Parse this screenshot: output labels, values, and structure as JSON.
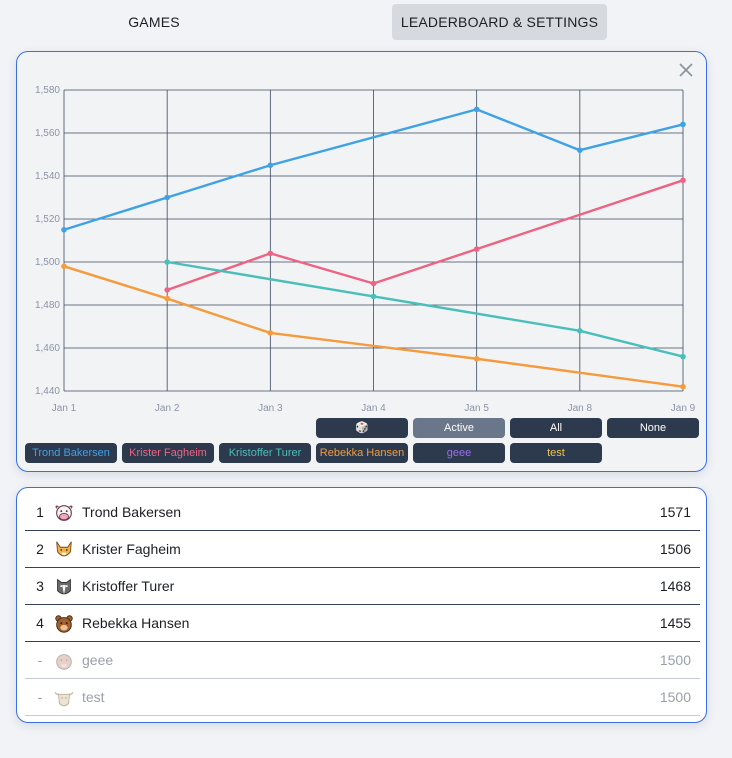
{
  "tabs": {
    "games": "GAMES",
    "leaderboard": "LEADERBOARD & SETTINGS"
  },
  "chart_data": {
    "type": "line",
    "categories": [
      "Jan 1",
      "Jan 2",
      "Jan 3",
      "Jan 4",
      "Jan 5",
      "Jan 8",
      "Jan 9"
    ],
    "y_ticks": [
      1440,
      1460,
      1480,
      1500,
      1520,
      1540,
      1560,
      1580
    ],
    "y_tick_labels": [
      "1,440",
      "1,460",
      "1,480",
      "1,500",
      "1,520",
      "1,540",
      "1,560",
      "1,580"
    ],
    "ylim": [
      1440,
      1580
    ],
    "grid": true,
    "series": [
      {
        "name": "Trond Bakersen",
        "color": "#3ea2e5",
        "values": [
          1515,
          1530,
          1545,
          null,
          1571,
          1552,
          1564
        ]
      },
      {
        "name": "Krister Fagheim",
        "color": "#ee6383",
        "values": [
          null,
          1487,
          1504,
          1490,
          1506,
          null,
          1538
        ]
      },
      {
        "name": "Kristoffer Turer",
        "color": "#4abfba",
        "values": [
          null,
          1500,
          null,
          1484,
          null,
          1468,
          1456
        ]
      },
      {
        "name": "Rebekka Hansen",
        "color": "#f39b3d",
        "values": [
          1498,
          1483,
          1467,
          null,
          1455,
          null,
          1442
        ]
      }
    ]
  },
  "controls": {
    "dice": "🎲",
    "active": "Active",
    "all": "All",
    "none": "None"
  },
  "player_buttons": [
    {
      "label": "Trond Bakersen",
      "color": "#3ea2e5"
    },
    {
      "label": "Krister Fagheim",
      "color": "#ee6383"
    },
    {
      "label": "Kristoffer Turer",
      "color": "#4abfba"
    },
    {
      "label": "Rebekka Hansen",
      "color": "#f39b3d"
    },
    {
      "label": "geee",
      "color": "#9c6cf0"
    },
    {
      "label": "test",
      "color": "#f1c34a"
    }
  ],
  "leaderboard": [
    {
      "rank": "1",
      "name": "Trond Bakersen",
      "rating": "1571",
      "avatar": "cow-icon"
    },
    {
      "rank": "2",
      "name": "Krister Fagheim",
      "rating": "1506",
      "avatar": "fox-icon"
    },
    {
      "rank": "3",
      "name": "Kristoffer Turer",
      "rating": "1468",
      "avatar": "dog-icon"
    },
    {
      "rank": "4",
      "name": "Rebekka Hansen",
      "rating": "1455",
      "avatar": "bear-icon"
    },
    {
      "rank": "-",
      "name": "geee",
      "rating": "1500",
      "avatar": "mole-icon"
    },
    {
      "rank": "-",
      "name": "test",
      "rating": "1500",
      "avatar": "ox-icon"
    }
  ]
}
